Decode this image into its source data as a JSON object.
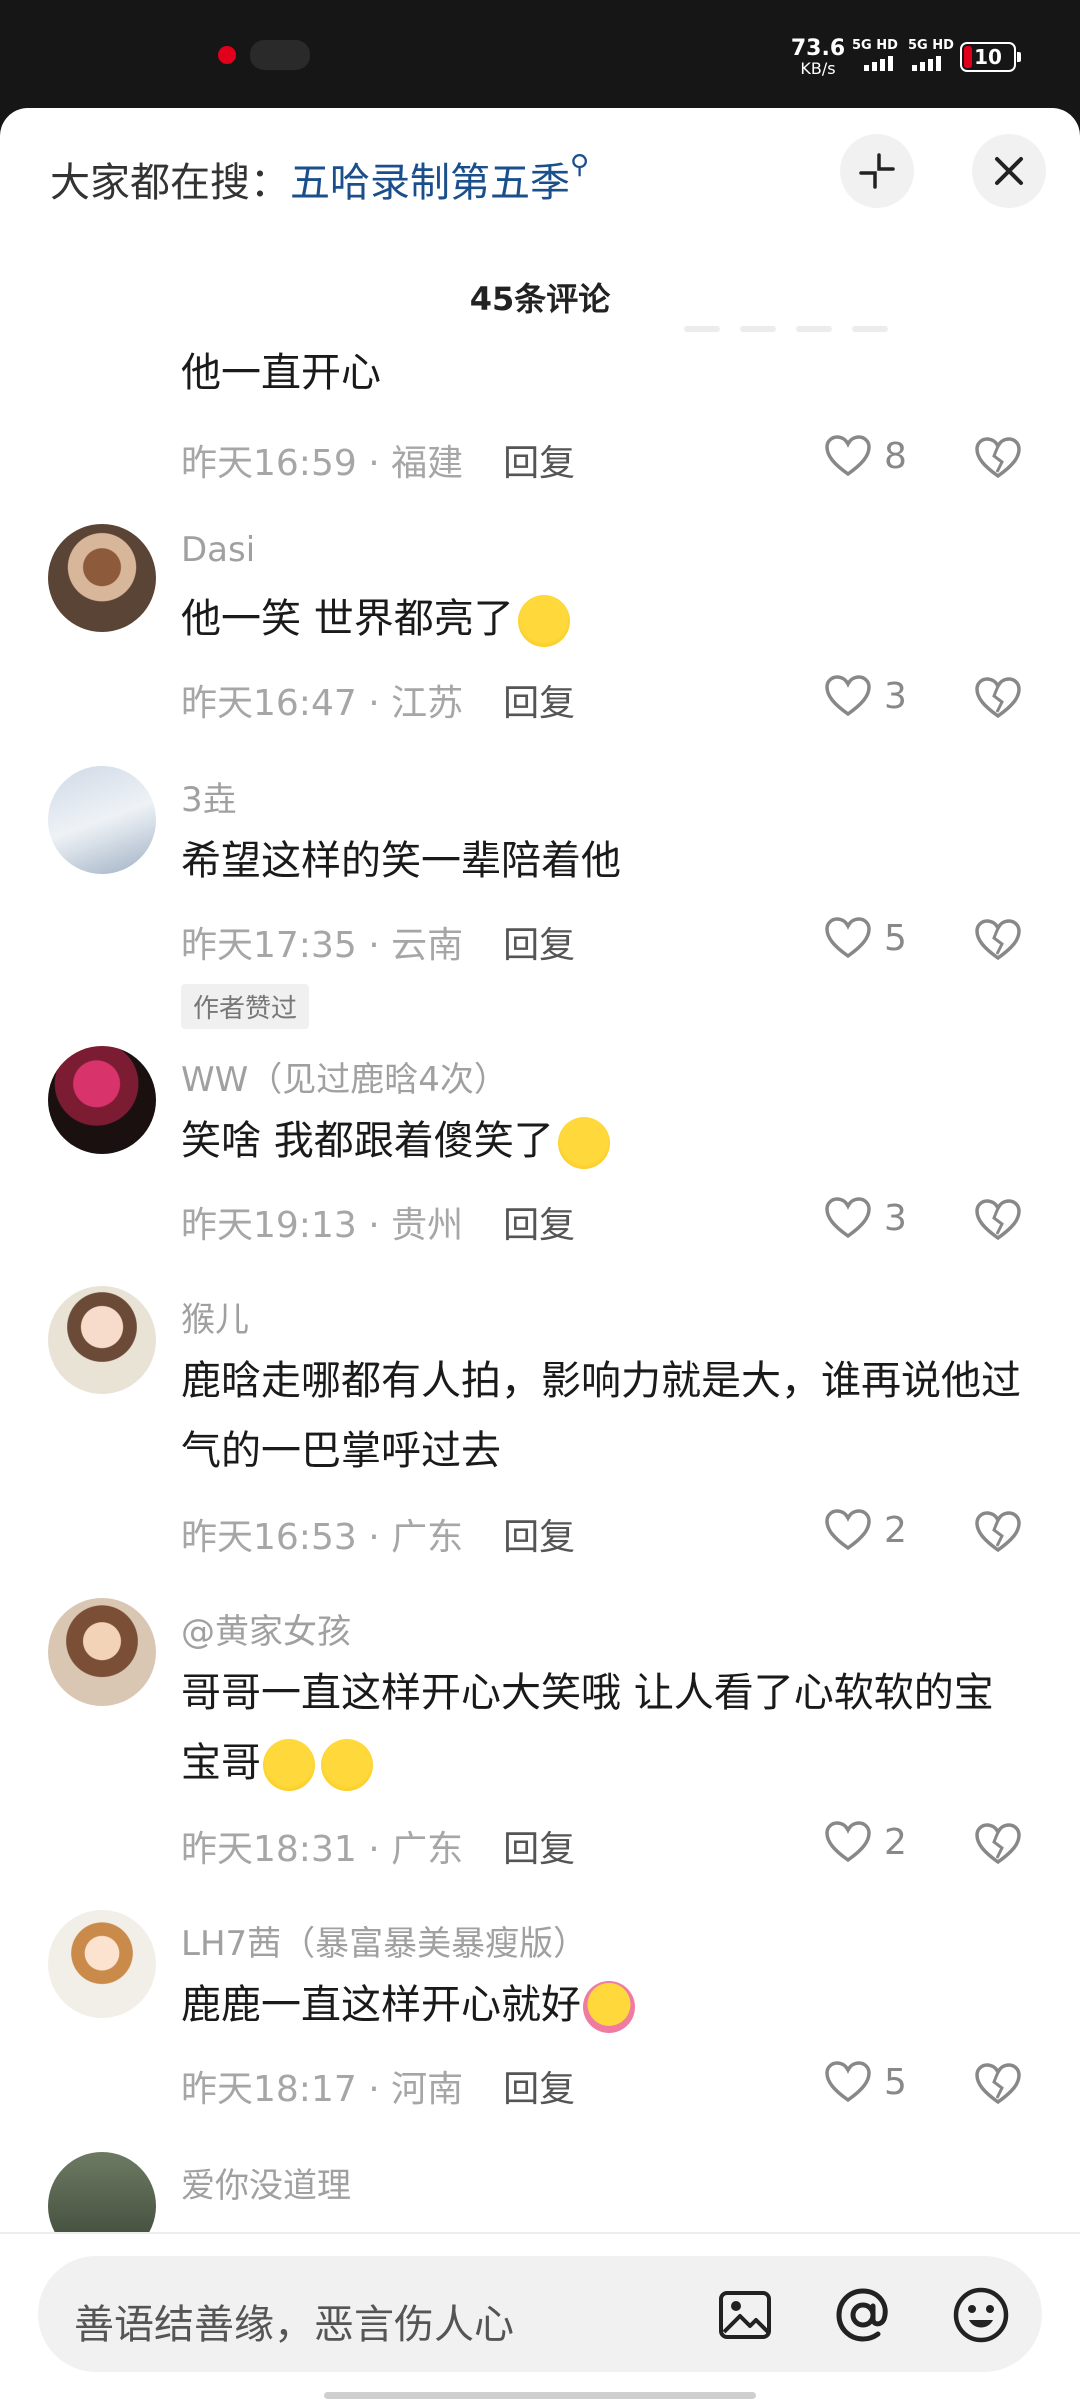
{
  "status_bar": {
    "net_speed_value": "73.6",
    "net_speed_unit": "KB/s",
    "sim1": "5G HD",
    "sim2": "5G HD",
    "battery": "10"
  },
  "header": {
    "search_prefix": "大家都在搜：",
    "search_keyword": "五哈录制第五季",
    "comment_count": "45条评论"
  },
  "comments": [
    {
      "name": "",
      "text": "他一直开心",
      "date": "昨天16:59",
      "location": "福建",
      "reply": "回复",
      "likes": "8"
    },
    {
      "name": "Dasi",
      "text": "他一笑 世界都亮了",
      "date": "昨天16:47",
      "location": "江苏",
      "reply": "回复",
      "likes": "3"
    },
    {
      "name": "3垚",
      "text": "希望这样的笑一辈陪着他",
      "date": "昨天17:35",
      "location": "云南",
      "reply": "回复",
      "likes": "5",
      "badge": "作者赞过"
    },
    {
      "name": "WW（见过鹿晗4次）",
      "text": "笑啥 我都跟着傻笑了",
      "date": "昨天19:13",
      "location": "贵州",
      "reply": "回复",
      "likes": "3"
    },
    {
      "name": "猴儿",
      "text": "鹿晗走哪都有人拍，影响力就是大，谁再说他过气的一巴掌呼过去",
      "date": "昨天16:53",
      "location": "广东",
      "reply": "回复",
      "likes": "2"
    },
    {
      "name": "@黄家女孩",
      "text": "哥哥一直这样开心大笑哦 让人看了心软软的宝宝哥",
      "date": "昨天18:31",
      "location": "广东",
      "reply": "回复",
      "likes": "2"
    },
    {
      "name": "LH7茜（暴富暴美暴瘦版）",
      "text": "鹿鹿一直这样开心就好",
      "date": "昨天18:17",
      "location": "河南",
      "reply": "回复",
      "likes": "5"
    },
    {
      "name": "爱你没道理",
      "text": "",
      "date": "",
      "location": "",
      "reply": "",
      "likes": ""
    }
  ],
  "input": {
    "placeholder": "善语结善缘，恶言伤人心"
  },
  "icons": [
    "collapse-icon",
    "close-icon",
    "heart-icon",
    "dislike-icon",
    "image-icon",
    "at-icon",
    "emoji-icon"
  ],
  "colors": {
    "keyword": "#1b4f8c",
    "battery_low": "#e0001b"
  }
}
